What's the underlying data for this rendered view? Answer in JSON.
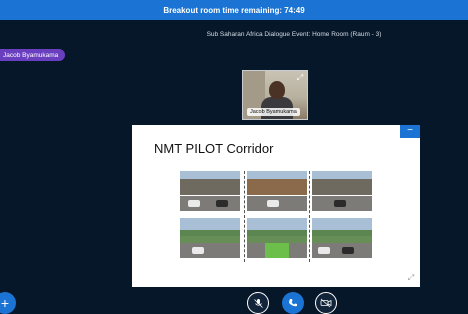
{
  "banner": {
    "text": "Breakout room time remaining: 74:49"
  },
  "meeting": {
    "title": "Sub Saharan Africa Dialogue Event: Home Room (Raum - 3)"
  },
  "presenter": {
    "name": "Jacob Byamukama"
  },
  "webcam": {
    "name": "Jacob Byamukama",
    "expand_icon": "expand-icon"
  },
  "slide": {
    "title": "NMT PILOT Corridor",
    "minimize_icon": "minimize-icon",
    "fullscreen_icon": "fullscreen-icon"
  },
  "controls": {
    "add_icon": "plus-icon",
    "mic_icon": "mic-muted-icon",
    "phone_icon": "phone-icon",
    "camera_icon": "camera-off-icon"
  },
  "colors": {
    "background": "#06172a",
    "accent": "#1b73d3",
    "presenter_tag": "#6a3fbf"
  }
}
